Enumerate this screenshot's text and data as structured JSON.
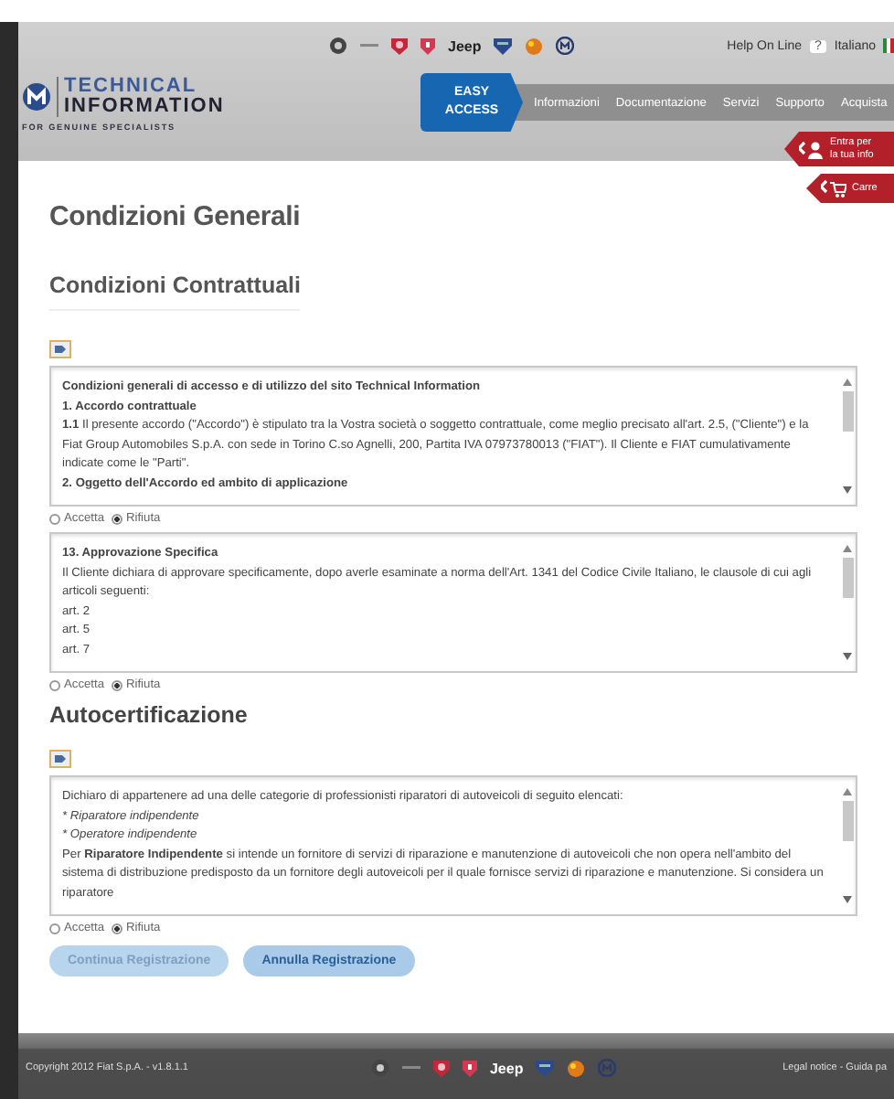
{
  "header": {
    "brand_text": "Jeep",
    "help": {
      "label": "Help On Line",
      "badge": "?"
    },
    "language": "Italiano",
    "logo": {
      "line1": "TECHNICAL",
      "line2": "INFORMATION",
      "tagline": "FOR GENUINE SPECIALISTS"
    },
    "easy_access": {
      "line1": "EASY",
      "line2": "ACCESS"
    },
    "nav": [
      "Informazioni",
      "Documentazione",
      "Servizi",
      "Supporto",
      "Acquista"
    ]
  },
  "side_tabs": [
    {
      "kind": "user",
      "label": "Entra per la tua info"
    },
    {
      "kind": "cart",
      "label": "Carre"
    }
  ],
  "page_title": "Condizioni Generali",
  "sections": [
    {
      "heading": "Condizioni Contrattuali",
      "boxes": [
        {
          "lines": [
            {
              "kind": "bold",
              "text": "Condizioni generali di accesso e di utilizzo del sito Technical Information"
            },
            {
              "kind": "bold",
              "text": "1. Accordo contrattuale"
            },
            {
              "kind": "text",
              "text": "**1.1** Il presente accordo (\"Accordo\") è stipulato tra la Vostra società o soggetto contrattuale, come meglio precisato all'art. 2.5, (\"Cliente\") e la Fiat Group Automobiles S.p.A. con sede in Torino C.so Agnelli, 200, Partita IVA 07973780013 (\"FIAT\"). Il Cliente e FIAT cumulativamente indicate come le \"Parti\"."
            },
            {
              "kind": "bold",
              "text": "2. Oggetto dell'Accordo ed ambito di applicazione"
            }
          ],
          "options": [
            {
              "label": "Accetta",
              "selected": false
            },
            {
              "label": "Rifiuta",
              "selected": true
            }
          ]
        },
        {
          "lines": [
            {
              "kind": "bold",
              "text": "13. Approvazione Specifica"
            },
            {
              "kind": "text",
              "text": "Il Cliente dichiara di approvare specificamente, dopo averle esaminate a norma dell'Art. 1341 del Codice Civile Italiano, le clausole di cui agli articoli seguenti:"
            },
            {
              "kind": "text",
              "text": "art. 2"
            },
            {
              "kind": "text",
              "text": "art. 5"
            },
            {
              "kind": "text",
              "text": "art. 7"
            }
          ],
          "options": [
            {
              "label": "Accetta",
              "selected": false
            },
            {
              "label": "Rifiuta",
              "selected": true
            }
          ]
        }
      ]
    },
    {
      "heading": "Autocertificazione",
      "boxes": [
        {
          "lines": [
            {
              "kind": "text",
              "text": "Dichiaro di appartenere ad una delle categorie di professionisti riparatori di autoveicoli di seguito elencati:"
            },
            {
              "kind": "italic",
              "text": "* Riparatore indipendente"
            },
            {
              "kind": "italic",
              "text": "* Operatore indipendente"
            },
            {
              "kind": "text",
              "text": "Per **Riparatore Indipendente** si intende un fornitore di servizi di riparazione e manutenzione di autoveicoli che non opera nell'ambito del sistema di distribuzione predisposto da un fornitore degli autoveicoli per il quale fornisce servizi di riparazione e manutenzione. Si considera un riparatore"
            }
          ],
          "options": [
            {
              "label": "Accetta",
              "selected": false
            },
            {
              "label": "Rifiuta",
              "selected": true
            }
          ]
        }
      ]
    }
  ],
  "buttons": [
    {
      "label": "Continua Registrazione",
      "disabled": true
    },
    {
      "label": "Annulla Registrazione",
      "disabled": false
    }
  ],
  "footer": {
    "copyright": "Copyright 2012 Fiat S.p.A. - v1.8.1.1",
    "brand_text": "Jeep",
    "links": "Legal notice - Guida pa"
  }
}
